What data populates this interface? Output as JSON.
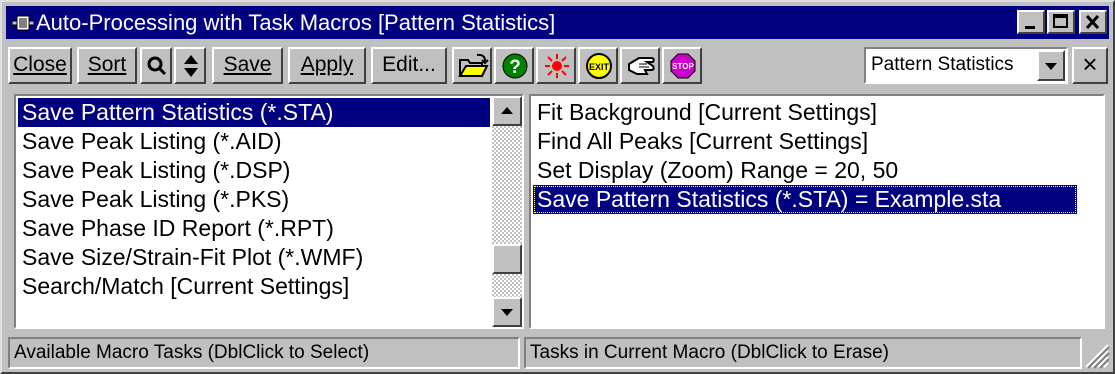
{
  "window": {
    "title": "Auto-Processing with Task Macros [Pattern Statistics]",
    "icon": "macro-app-icon",
    "controls": [
      "minimize-icon",
      "maximize-icon",
      "close-icon"
    ]
  },
  "toolbar": {
    "close_label": "Close",
    "sort_label": "Sort",
    "save_label": "Save",
    "apply_label": "Apply",
    "edit_label": "Edit...",
    "icons": [
      "search-icon",
      "updown-arrows-icon",
      "open-folder-icon",
      "help-icon",
      "burst-icon",
      "exit-icon",
      "hand-icon",
      "stop-icon"
    ],
    "macro_select": {
      "value": "Pattern Statistics"
    },
    "dismiss_label": "×"
  },
  "available_tasks": {
    "items": [
      "Save Pattern Statistics (*.STA)",
      "Save Peak Listing (*.AID)",
      "Save Peak Listing (*.DSP)",
      "Save Peak Listing (*.PKS)",
      "Save Phase ID Report (*.RPT)",
      "Save Size/Strain-Fit Plot (*.WMF)",
      "Search/Match [Current Settings]"
    ],
    "selected_index": 0
  },
  "macro_tasks": {
    "items": [
      "Fit Background [Current Settings]",
      "Find All Peaks [Current Settings]",
      "Set Display (Zoom) Range = 20, 50",
      "Save Pattern Statistics (*.STA) = Example.sta"
    ],
    "selected_index": 3
  },
  "status": {
    "left": "Available Macro Tasks (DblClick to Select)",
    "right": "Tasks in Current Macro (DblClick to Erase)"
  },
  "colors": {
    "titlebar": "#000080",
    "face": "#c0c0c0",
    "selection": "#000080"
  }
}
